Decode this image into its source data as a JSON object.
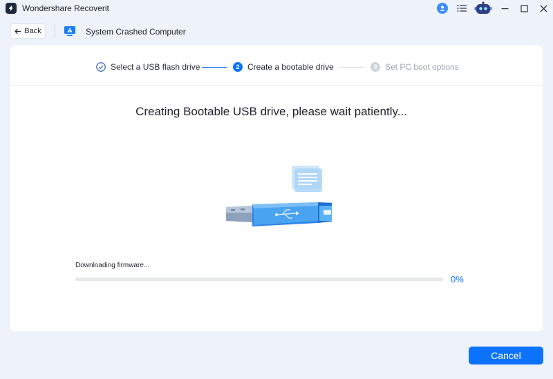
{
  "app": {
    "title": "Wondershare Recoverit"
  },
  "titlebar": {
    "icons": [
      "account-icon",
      "menu-icon",
      "robot-assistant-icon",
      "minimize-icon",
      "maximize-icon",
      "close-icon"
    ]
  },
  "header": {
    "back_label": "Back",
    "mode_title": "System Crashed Computer"
  },
  "steps": [
    {
      "number": "1",
      "label": "Select a USB flash drive",
      "state": "done"
    },
    {
      "number": "2",
      "label": "Create a bootable drive",
      "state": "active"
    },
    {
      "number": "3",
      "label": "Set PC boot options",
      "state": "pending"
    }
  ],
  "main": {
    "heading": "Creating Bootable USB drive, please wait patiently...",
    "progress_label": "Downloading firmware...",
    "progress_percent_text": "0%",
    "progress_fraction": 0
  },
  "footer": {
    "cancel_label": "Cancel"
  },
  "colors": {
    "accent": "#0d73ff",
    "background": "#eef3fb",
    "panel": "#ffffff"
  }
}
